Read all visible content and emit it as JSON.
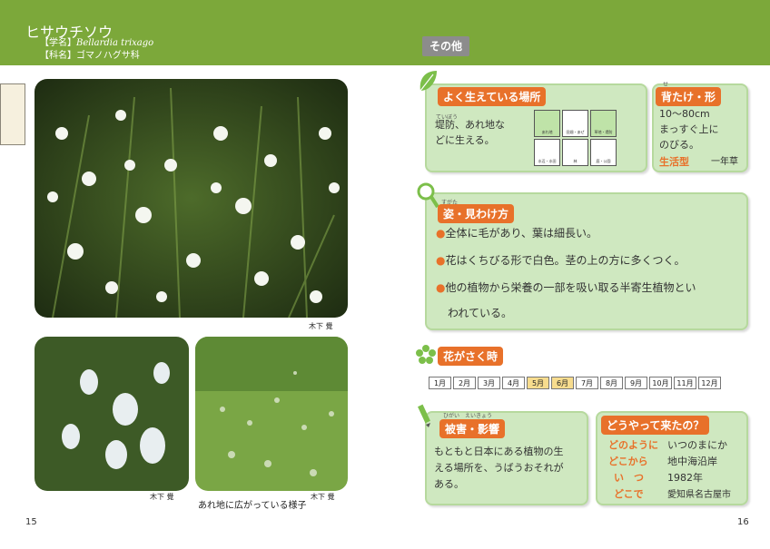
{
  "header": {
    "title": "ヒサウチソウ",
    "scientific_label": "【学名】",
    "scientific_name": "Bellardia trixago",
    "family_label": "【科名】",
    "family_name": "ゴマノハグサ科"
  },
  "photos": {
    "credit_main": "木下 覺",
    "credit_left": "木下 覺",
    "credit_right": "木下 覺",
    "caption_right": "あれ地に広がっている様子"
  },
  "section_label": "その他",
  "habitat": {
    "heading": "よく生えている場所",
    "text_line1": "堤防、あれ地な",
    "text_line2": "どに生える。",
    "ruby": "ていぼう",
    "icons": [
      {
        "label": "あれ地",
        "active": true
      },
      {
        "label": "田畑・あぜ",
        "active": false
      },
      {
        "label": "草地・堤防",
        "active": true
      },
      {
        "label": "水辺・水田",
        "active": false
      },
      {
        "label": "林",
        "active": false
      },
      {
        "label": "庭・公園",
        "active": false
      }
    ]
  },
  "height": {
    "heading": "背たけ・形",
    "ruby": "せ",
    "line1": "10～80cm",
    "line2": "まっすぐ上に",
    "line3": "のびる。",
    "life_label": "生活型",
    "life_value": "一年草"
  },
  "shape": {
    "heading": "姿・見わけ方",
    "ruby": "すがた",
    "bullet1": "全体に毛があり、葉は細長い。",
    "bullet2": "花はくちびる形で白色。茎の上の方に多くつく。",
    "bullet3": "他の植物から栄養の一部を吸い取る半寄生植物とい",
    "bullet3b": "われている。"
  },
  "bloom": {
    "heading": "花がさく時",
    "months": [
      "1月",
      "2月",
      "3月",
      "4月",
      "5月",
      "6月",
      "7月",
      "8月",
      "9月",
      "10月",
      "11月",
      "12月"
    ],
    "active_months": [
      "5月",
      "6月"
    ]
  },
  "damage": {
    "heading": "被害・影響",
    "ruby": "ひがい　えいきょう",
    "line1": "もともと日本にある植物の生",
    "line2": "える場所を、うばうおそれが",
    "line3": "ある。"
  },
  "origin": {
    "heading": "どうやって来たの？",
    "how_label": "どのように",
    "how_value": "いつのまにか",
    "from_label": "どこから",
    "from_value": "地中海沿岸",
    "when_label": "い　つ",
    "when_value": "1982年",
    "where_label": "どこで",
    "where_value": "愛知県名古屋市"
  },
  "pages": {
    "left": "15",
    "right": "16"
  },
  "colors": {
    "green_bar": "#7ca83a",
    "accent": "#e8712a",
    "card_bg": "#cfe8c0"
  }
}
